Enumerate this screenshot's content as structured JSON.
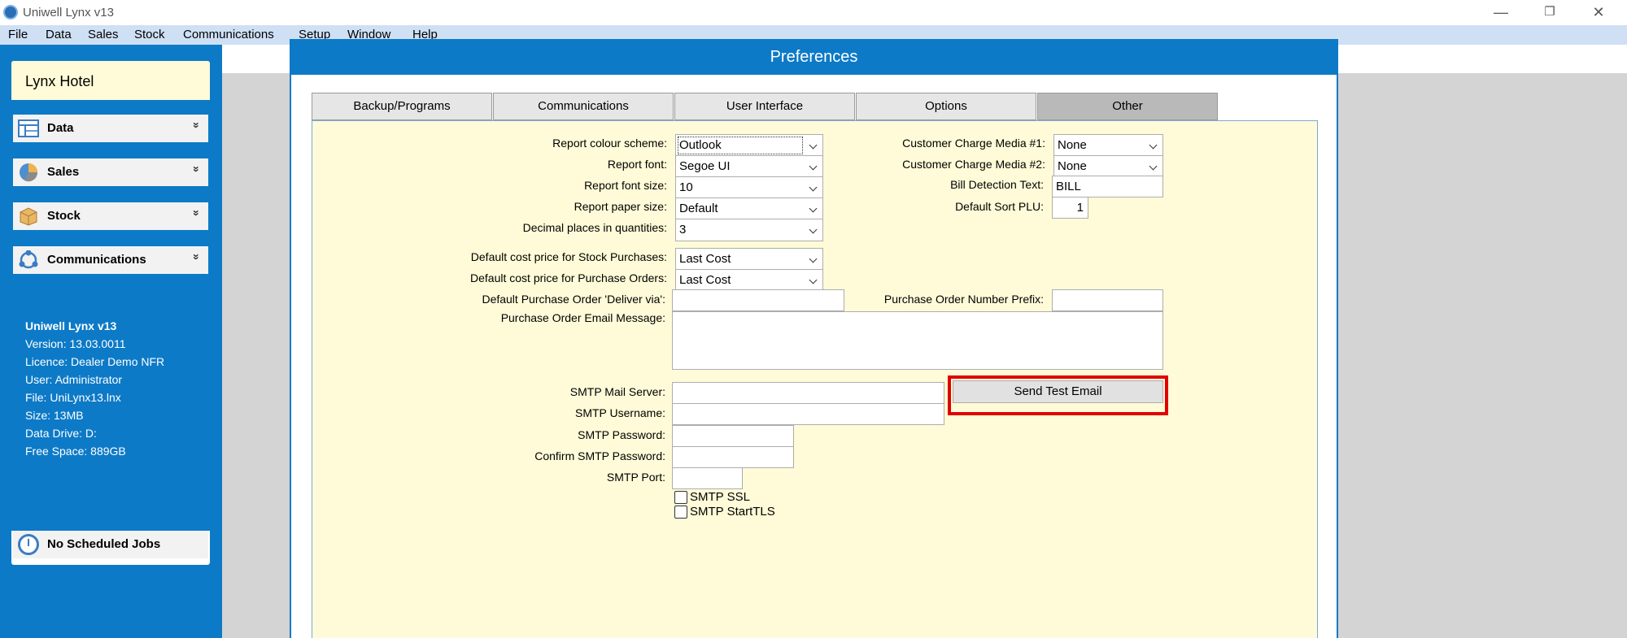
{
  "window": {
    "title": "Uniwell Lynx v13",
    "minimize": "—",
    "restore": "❐",
    "close": "✕"
  },
  "menu": [
    "File",
    "Data",
    "Sales",
    "Stock",
    "Communications",
    "Setup",
    "Window",
    "Help"
  ],
  "sidebar": {
    "hotel_name": "Lynx Hotel",
    "items": [
      {
        "label": "Data",
        "icon": "data-icon"
      },
      {
        "label": "Sales",
        "icon": "pie-chart-icon"
      },
      {
        "label": "Stock",
        "icon": "box-icon"
      },
      {
        "label": "Communications",
        "icon": "network-icon"
      }
    ],
    "chevron": "»",
    "info": {
      "app": "Uniwell Lynx v13",
      "version": "Version: 13.03.0011",
      "licence": "Licence: Dealer Demo NFR",
      "user": "User: Administrator",
      "file": "File: UniLynx13.lnx",
      "size": "Size: 13MB",
      "drive": "Data Drive: D:",
      "free": "Free Space: 889GB"
    },
    "jobs": "No Scheduled Jobs"
  },
  "dialog": {
    "title": "Preferences",
    "tabs": [
      "Backup/Programs",
      "Communications",
      "User Interface",
      "Options",
      "Other"
    ],
    "active_tab": "Other",
    "fields": {
      "report_colour_scheme": {
        "label": "Report colour scheme:",
        "value": "Outlook"
      },
      "report_font": {
        "label": "Report font:",
        "value": "Segoe UI"
      },
      "report_font_size": {
        "label": "Report font size:",
        "value": "10"
      },
      "report_paper_size": {
        "label": "Report paper size:",
        "value": "Default"
      },
      "decimal_places": {
        "label": "Decimal places in quantities:",
        "value": "3"
      },
      "cost_stock_purchases": {
        "label": "Default cost price for Stock Purchases:",
        "value": "Last Cost"
      },
      "cost_purchase_orders": {
        "label": "Default cost price for Purchase Orders:",
        "value": "Last Cost"
      },
      "po_deliver_via": {
        "label": "Default Purchase Order 'Deliver via':",
        "value": ""
      },
      "po_email_message": {
        "label": "Purchase Order Email Message:",
        "value": ""
      },
      "charge_media_1": {
        "label": "Customer Charge Media #1:",
        "value": "None"
      },
      "charge_media_2": {
        "label": "Customer Charge Media #2:",
        "value": "None"
      },
      "bill_detection": {
        "label": "Bill Detection Text:",
        "value": "BILL"
      },
      "default_sort_plu": {
        "label": "Default Sort PLU:",
        "value": "1"
      },
      "po_number_prefix": {
        "label": "Purchase Order Number Prefix:",
        "value": ""
      },
      "smtp_server": {
        "label": "SMTP Mail Server:",
        "value": ""
      },
      "smtp_username": {
        "label": "SMTP Username:",
        "value": ""
      },
      "smtp_password": {
        "label": "SMTP Password:",
        "value": ""
      },
      "smtp_confirm": {
        "label": "Confirm SMTP Password:",
        "value": ""
      },
      "smtp_port": {
        "label": "SMTP Port:",
        "value": ""
      },
      "smtp_ssl": {
        "label": "SMTP SSL",
        "checked": false
      },
      "smtp_starttls": {
        "label": "SMTP StartTLS",
        "checked": false
      }
    },
    "send_test_email": "Send Test Email",
    "highlight_color": "#e00000"
  }
}
